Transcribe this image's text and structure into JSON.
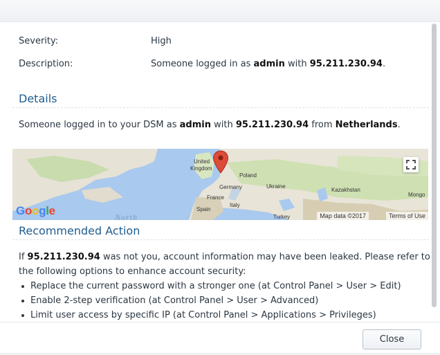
{
  "details": {
    "severity_label": "Severity:",
    "severity_value": "High",
    "description_label": "Description:",
    "description_prefix": "Someone logged in as ",
    "description_user": "admin",
    "description_mid": " with ",
    "description_ip": "95.211.230.94",
    "description_suffix": "."
  },
  "details_section": {
    "title": "Details",
    "text_prefix": "Someone logged in to your DSM as ",
    "user": "admin",
    "mid": " with ",
    "ip": "95.211.230.94",
    "from": " from ",
    "country": "Netherlands",
    "suffix": "."
  },
  "map": {
    "labels": {
      "united": "United",
      "kingdom": "Kingdom",
      "poland": "Poland",
      "germany": "Germany",
      "ukraine": "Ukraine",
      "kazakhstan": "Kazakhstan",
      "france": "France",
      "mongo": "Mongo",
      "spain": "Spain",
      "italy": "Italy",
      "turkey": "Turkey",
      "north": "North"
    },
    "google_logo": "Google",
    "map_data": "Map data ©2017",
    "terms": "Terms of Use",
    "marker_color": "#dd4b39"
  },
  "recommended": {
    "title": "Recommended Action",
    "line1_prefix": "If ",
    "line1_ip": "95.211.230.94",
    "line1_suffix": " was not you, account information may have been leaked. Please refer to",
    "line2": "the following options to enhance account security:",
    "bullets": [
      "Replace the current password with a stronger one (at Control Panel > User > Edit)",
      "Enable 2-step verification (at Control Panel > User > Advanced)",
      "Limit user access by specific IP (at Control Panel > Applications > Privileges)"
    ]
  },
  "footer": {
    "close_label": "Close"
  },
  "colors": {
    "accent": "#1f5c8f",
    "sea": "#a9c9ee",
    "land": "#e7e3d8"
  }
}
